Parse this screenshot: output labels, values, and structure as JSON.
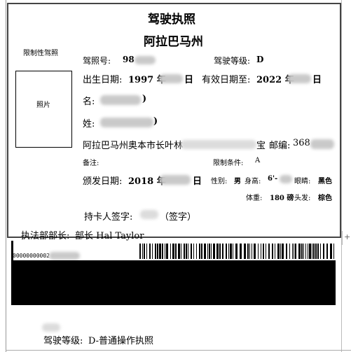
{
  "license": {
    "title": "驾驶执照",
    "state": "阿拉巴马州",
    "restricted_label": "限制性驾照",
    "photo_label": "照片",
    "license_no_label": "驾照号:",
    "license_no_visible": "98",
    "class_label": "驾驶等级:",
    "class_value": "D",
    "dob_label": "出生日期:",
    "dob_year": "1997 年",
    "dob_day_suffix": "日",
    "expiry_label": "有效日期至:",
    "expiry_year": "2022 年",
    "expiry_day_suffix": "日",
    "first_name_label": "名:",
    "first_name_suffix": ")",
    "last_name_label": "姓:",
    "last_name_suffix": ")",
    "address_prefix": "阿拉巴马州奥本市长叶林",
    "address_mid": "宝",
    "zip_label": "邮编:",
    "zip_visible": "368",
    "notes_label": "备注:",
    "restriction_label": "限制条件:",
    "restriction_value": "A",
    "issue_label": "颁发日期:",
    "issue_year": "2018 年",
    "issue_day_suffix": "日",
    "sex_label": "性别:",
    "sex_value": "男",
    "height_label": "身高:",
    "height_value": "6'-",
    "eye_label": "眼睛:",
    "eye_value": "黑色",
    "weight_label": "体重:",
    "weight_value": "180 磅",
    "hair_label": "头发:",
    "hair_value": "棕色",
    "signature_label": "持卡人签字:",
    "signature_hint": "（签字）",
    "director_label": "执法部部长:",
    "director_value": "部长 Hal Taylor",
    "barcode_number": "00000000002",
    "class_footer_label": "驾驶等级:",
    "class_footer_value": "D-普通操作执照"
  },
  "scroll_button_symbol": "+"
}
